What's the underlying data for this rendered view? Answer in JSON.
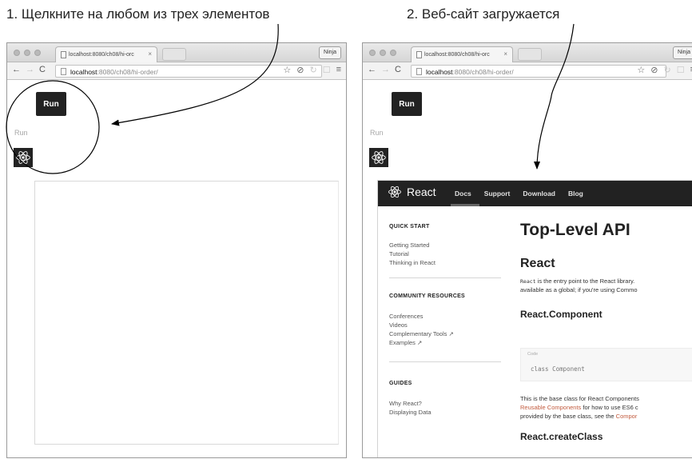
{
  "captions": {
    "step1": "1. Щелкните на любом из трех элементов",
    "step2": "2. Веб-сайт загружается"
  },
  "browser": {
    "tab_title": "localhost:8080/ch08/hi-orc ×",
    "tab_title_short": "localhost:8080/ch08/hi-orc",
    "tab_close": "×",
    "profile_label": "Ninja",
    "url_host": "localhost",
    "url_path": ":8080/ch08/hi-order/",
    "icons": [
      "back-icon",
      "forward-icon",
      "reload-icon",
      "page-icon",
      "star-icon",
      "block-icon",
      "extension-icon",
      "menu-icon"
    ]
  },
  "app": {
    "run_button_label": "Run",
    "run_text_label": "Run",
    "react_logo_icon": "react-atom-icon"
  },
  "react_site": {
    "brand": "React",
    "nav_links": [
      "Docs",
      "Support",
      "Download",
      "Blog"
    ],
    "sidebar": {
      "quick_start_heading": "QUICK START",
      "quick_start_items": [
        "Getting Started",
        "Tutorial",
        "Thinking in React"
      ],
      "community_heading": "COMMUNITY RESOURCES",
      "community_items": [
        "Conferences",
        "Videos",
        "Complementary Tools ↗",
        "Examples ↗"
      ],
      "guides_heading": "GUIDES",
      "guides_items": [
        "Why React?",
        "Displaying Data"
      ]
    },
    "content": {
      "title": "Top-Level API",
      "section_react": "React",
      "react_para_code": "React",
      "react_para_line1": " is the entry point to the React library.",
      "react_para_line2": "available as a global; if you're using Commo",
      "section_component": "React.Component",
      "code_label": "Code",
      "code_text": "class Component",
      "component_para_line1": "This is the base class for React Components",
      "component_para_line2_link": "Reusable Components",
      "component_para_line2_rest": " for how to use ES6 c",
      "component_para_line3": "provided by the base class, see the ",
      "component_para_line3_link": "Compor",
      "section_create_class": "React.createClass"
    }
  },
  "colors": {
    "react_nav_bg": "#222222",
    "react_link": "#c25b3e",
    "react_logo_blue": "#61dafb",
    "annotation": "#000000"
  }
}
